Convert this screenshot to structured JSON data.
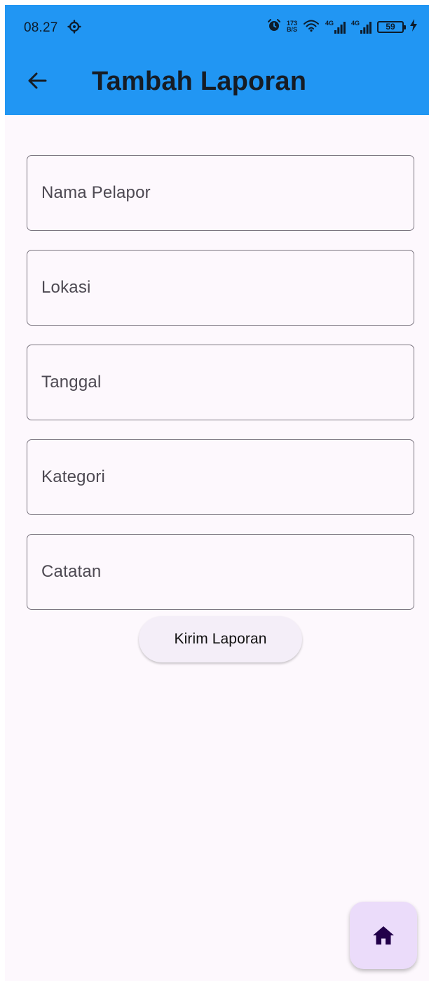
{
  "status_bar": {
    "time": "08.27",
    "net_speed_value": "173",
    "net_speed_unit": "B/S",
    "sim1_tag": "4G",
    "sim2_tag": "4G",
    "battery_level": "59"
  },
  "app_bar": {
    "title": "Tambah Laporan",
    "background_color": "#2196f3"
  },
  "form": {
    "fields": [
      {
        "label": "Nama Pelapor"
      },
      {
        "label": "Lokasi"
      },
      {
        "label": "Tanggal"
      },
      {
        "label": "Kategori"
      },
      {
        "label": "Catatan"
      }
    ],
    "submit_label": "Kirim Laporan"
  },
  "fab": {
    "icon": "home-icon",
    "color": "#ebdcfa"
  }
}
